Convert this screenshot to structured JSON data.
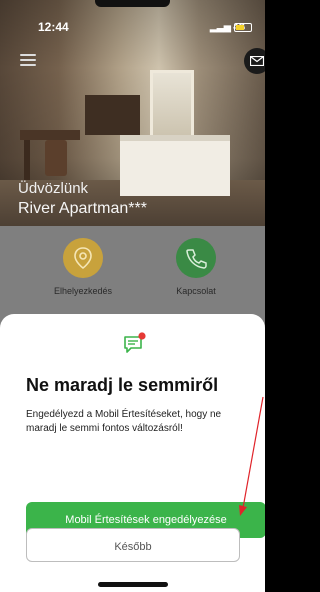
{
  "status": {
    "time": "12:44",
    "network": "4G",
    "battery_level": 0.6
  },
  "hero": {
    "welcome": "Üdvözlünk",
    "hotel_name": "River Apartman***"
  },
  "features": [
    {
      "label": "Elhelyezkedés",
      "icon": "location-pin-icon",
      "color": "#e8b83a"
    },
    {
      "label": "Kapcsolat",
      "icon": "phone-icon",
      "color": "#3aa54a"
    }
  ],
  "modal": {
    "title": "Ne maradj le semmiről",
    "description": "Engedélyezd a Mobil Értesítéseket, hogy ne maradj le semmi fontos változásról!",
    "primary_label": "Mobil Értesítések engedélyezése",
    "secondary_label": "Később"
  },
  "colors": {
    "primary": "#3bb44a",
    "badge": "#e53935",
    "annotation_arrow": "#e0242a"
  }
}
